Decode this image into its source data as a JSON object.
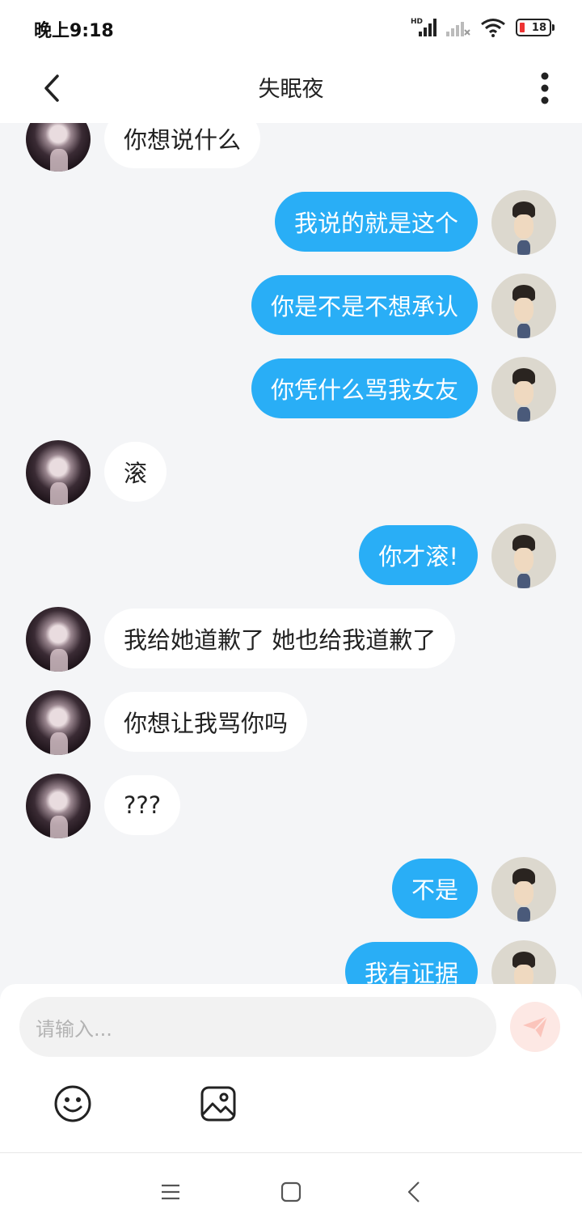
{
  "status_bar": {
    "time": "晚上9:18",
    "network": "HD",
    "battery": "18"
  },
  "header": {
    "title": "失眠夜"
  },
  "messages": [
    {
      "side": "other",
      "text": "你想说什么"
    },
    {
      "side": "self",
      "text": "我说的就是这个"
    },
    {
      "side": "self",
      "text": "你是不是不想承认"
    },
    {
      "side": "self",
      "text": "你凭什么骂我女友"
    },
    {
      "side": "other",
      "text": "滚"
    },
    {
      "side": "self",
      "text": "你才滚!"
    },
    {
      "side": "other",
      "text": "我给她道歉了 她也给我道歉了"
    },
    {
      "side": "other",
      "text": "你想让我骂你吗"
    },
    {
      "side": "other",
      "text": "???"
    },
    {
      "side": "self",
      "text": "不是"
    },
    {
      "side": "self",
      "text": "我有证据"
    }
  ],
  "input": {
    "placeholder": "请输入..."
  },
  "colors": {
    "self_bubble": "#29aef6",
    "other_bubble": "#ffffff",
    "background": "#f4f5f7"
  }
}
